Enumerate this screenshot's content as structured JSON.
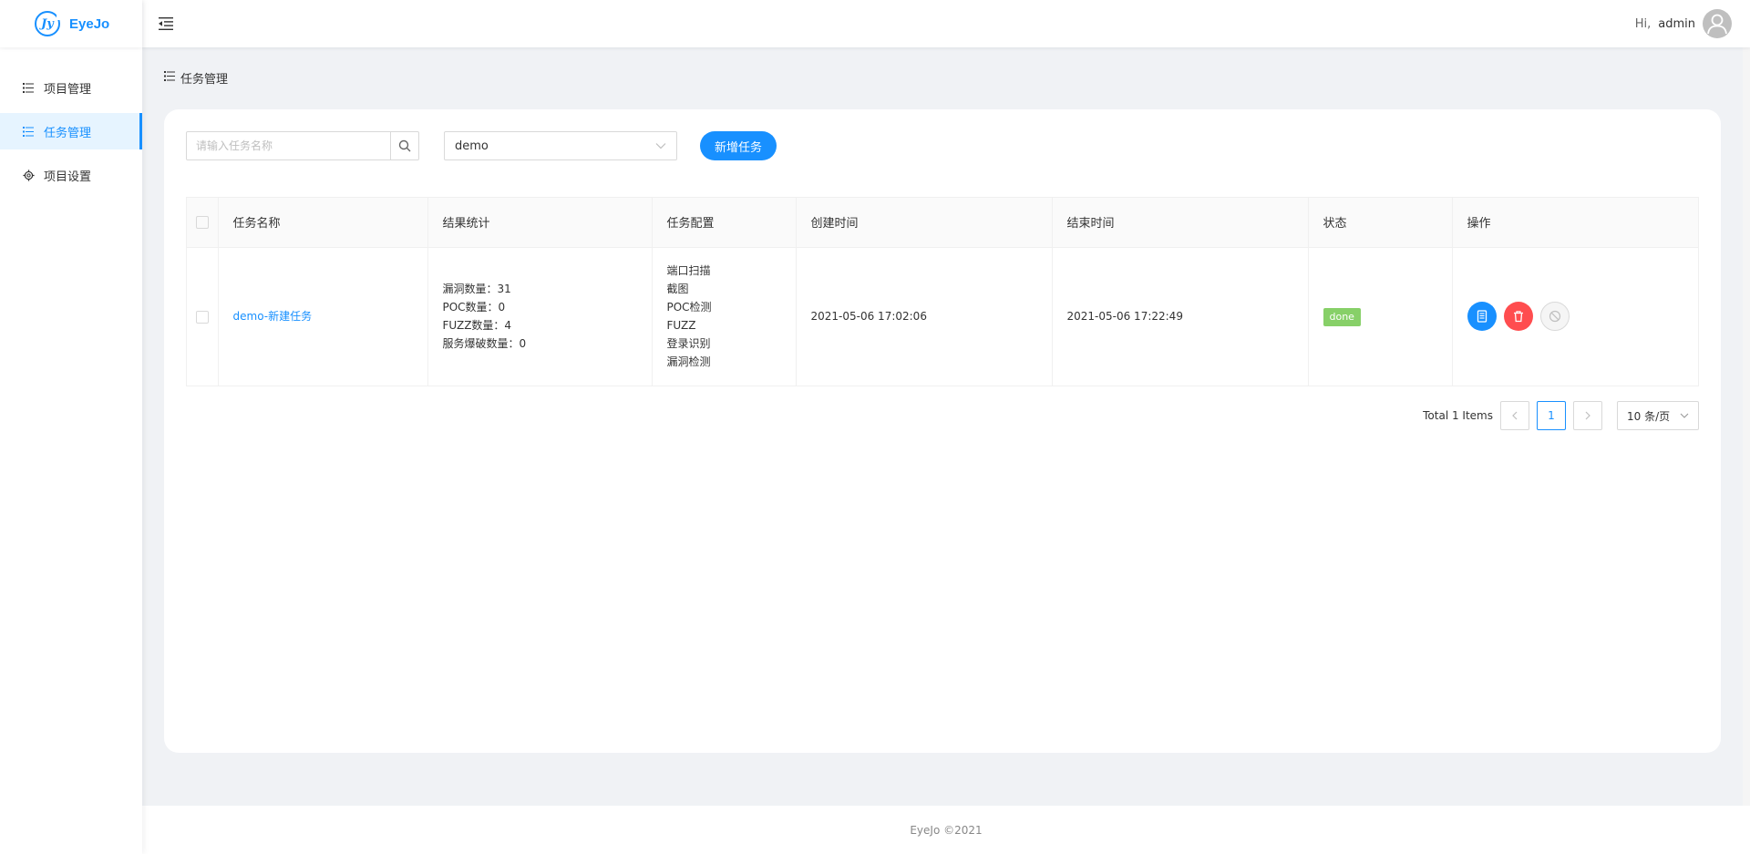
{
  "app": {
    "name": "EyeJo"
  },
  "sidebar": {
    "items": [
      {
        "label": "项目管理",
        "icon": "list-icon",
        "active": false
      },
      {
        "label": "任务管理",
        "icon": "list-icon",
        "active": true
      },
      {
        "label": "项目设置",
        "icon": "gear-icon",
        "active": false
      }
    ]
  },
  "header": {
    "greeting": "Hi,",
    "username": "admin"
  },
  "breadcrumb": {
    "label": "任务管理"
  },
  "toolbar": {
    "search_placeholder": "请输入任务名称",
    "project_select_value": "demo",
    "add_button_label": "新增任务"
  },
  "table": {
    "columns": [
      "任务名称",
      "结果统计",
      "任务配置",
      "创建时间",
      "结束时间",
      "状态",
      "操作"
    ],
    "rows": [
      {
        "name": "demo-新建任务",
        "stats": [
          "漏洞数量：31",
          "POC数量：0",
          "FUZZ数量：4",
          "服务爆破数量：0"
        ],
        "config": [
          "端口扫描",
          "截图",
          "POC检测",
          "FUZZ",
          "登录识别",
          "漏洞检测"
        ],
        "created": "2021-05-06 17:02:06",
        "finished": "2021-05-06 17:22:49",
        "status": "done"
      }
    ]
  },
  "pagination": {
    "total_text": "Total 1 Items",
    "current_page": "1",
    "page_size": "10 条/页"
  },
  "footer": {
    "text": "EyeJo ©2021"
  },
  "colors": {
    "primary": "#1890ff",
    "danger": "#ff4d4f",
    "success": "#87d068"
  }
}
